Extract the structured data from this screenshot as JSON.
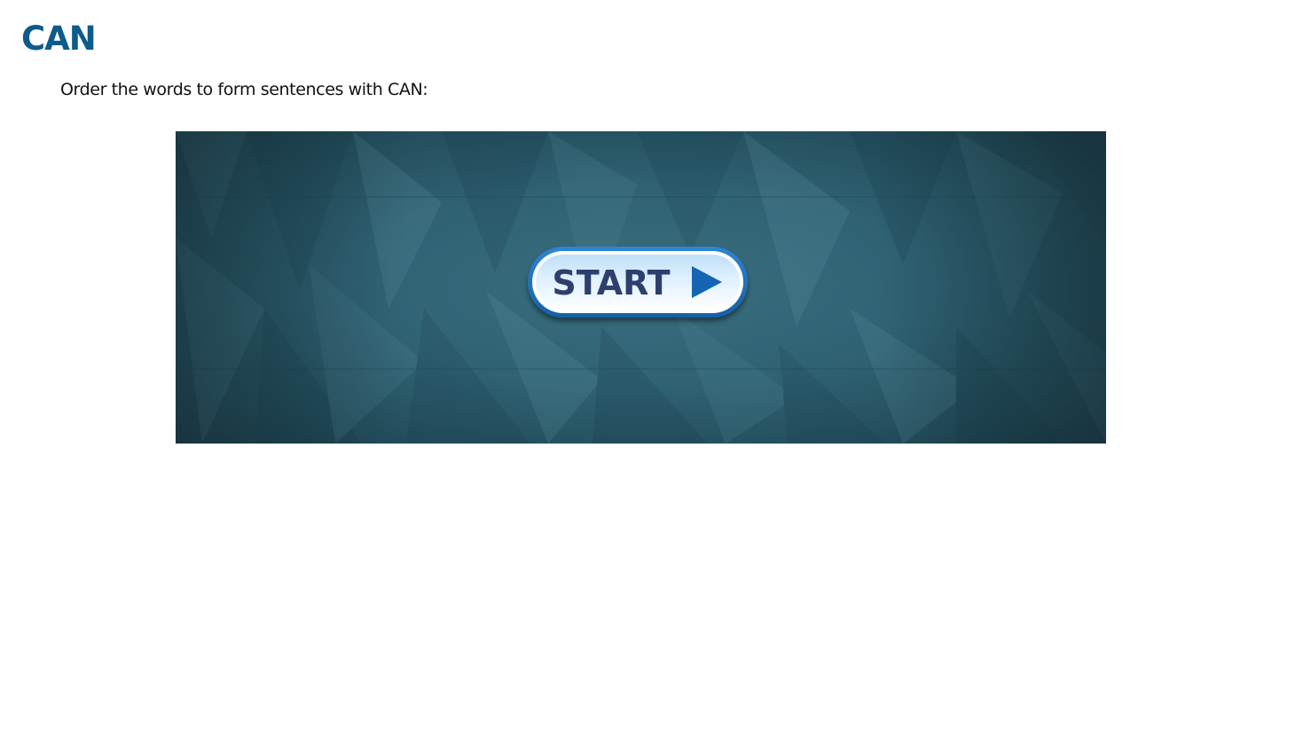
{
  "page": {
    "title": "CAN",
    "instructions": "Order the words to form sentences with CAN:"
  },
  "game": {
    "start_button_label": "START",
    "start_icon": "play-triangle-icon",
    "colors": {
      "title": "#0d5b8c",
      "background": "#2f6273",
      "button_border": "#1460a8",
      "button_text": "#2d3f6e",
      "play_icon": "#1466b4"
    }
  }
}
